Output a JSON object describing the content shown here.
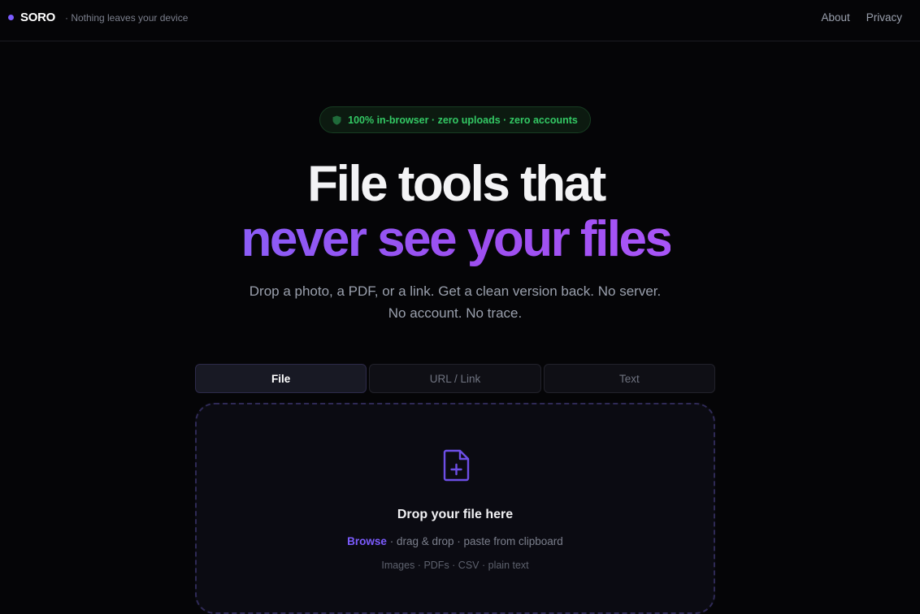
{
  "header": {
    "brand": "SORO",
    "tagline": "· Nothing leaves your device",
    "nav": [
      "About",
      "Privacy"
    ]
  },
  "badge": {
    "icon": "shield-icon",
    "text": "100% in-browser · zero uploads · zero accounts"
  },
  "hero": {
    "line1": "File tools that",
    "line2": "never see your files",
    "subtitle": "Drop a photo, a PDF, or a link. Get a clean version back. No server. No account. No trace."
  },
  "tabs": [
    {
      "label": "File",
      "active": true
    },
    {
      "label": "URL / Link",
      "active": false
    },
    {
      "label": "Text",
      "active": false
    }
  ],
  "dropzone": {
    "icon": "file-plus-icon",
    "title": "Drop your file here",
    "browse": "Browse",
    "actions": " · drag & drop · paste from clipboard",
    "types": "Images · PDFs · CSV · plain text"
  },
  "colors": {
    "accent": "#7c5cff",
    "gradient_start": "#8b5cf6",
    "gradient_end": "#a855f7",
    "badge_green": "#33c864",
    "background": "#050507"
  }
}
